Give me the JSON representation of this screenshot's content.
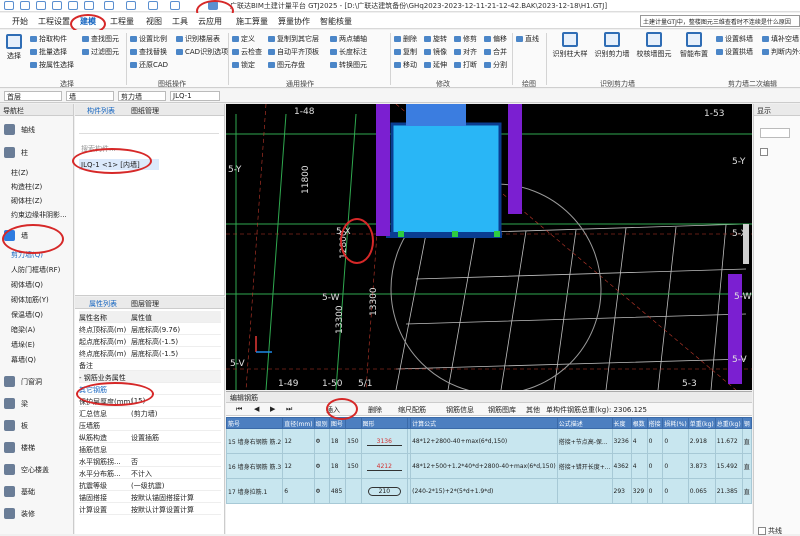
{
  "titlebar": {
    "title": "广联达BIM土建计量平台 GTJ2025 - [D:\\广联达建筑备份\\GHq2023-2023-12-11-21-12-42.BAK\\2023-12-18\\H1.GTJ]"
  },
  "menu": [
    "开始",
    "工程设置",
    "建模",
    "工程量",
    "视图",
    "工具",
    "云应用",
    "施工算量",
    "算量协作",
    "智能核量"
  ],
  "notice": "土建计量GTJ中，整楼图元三维查看时不连续是什么原因",
  "ribbon": {
    "select": "选择",
    "pick": "拾取构件",
    "batch": "批量选择",
    "attr_batch": "按属性选择",
    "find": "查找图元",
    "filter": "过滤图元",
    "set_ratio": "设置比例",
    "restore_cad": "还原CAD",
    "find_replace": "查找替换",
    "recognize_floor": "识别楼层表",
    "cad_recog": "CAD识别选项",
    "define": "定义",
    "cloud_check": "云检查",
    "lock": "锁定",
    "two_point": "两点辅轴",
    "auto_level": "自动平齐顶板",
    "copy_to": "复制到其它层",
    "long_edit": "长度标注",
    "convert": "转换图元",
    "trim": "图元存盘",
    "delete": "删除",
    "copy": "复制",
    "move": "移动",
    "rotate": "旋转",
    "mirror": "镜像",
    "extend": "延伸",
    "trim2": "修剪",
    "align": "对齐",
    "offset": "偏移",
    "break": "打断",
    "merge": "合并",
    "split": "分割",
    "draw": "直线",
    "recognize_col": "识别柱大样",
    "recognize_wall": "识别剪力墙",
    "recognize_table": "识别剪力墙表",
    "calib_wall": "校核墙图元",
    "smart_layout": "智能布置",
    "set_joint": "设置斜墙",
    "set_arc": "设置拱墙",
    "fill_pile": "填补空墙",
    "check_wall": "判断内外墙",
    "groups": [
      "选择",
      "图纸操作",
      "通用操作",
      "修改",
      "绘图",
      "识别剪力墙",
      "剪力墙二次编辑"
    ]
  },
  "ctxbar": {
    "floor": "首层",
    "type": "墙",
    "subtype": "剪力墙",
    "item": "JLQ-1"
  },
  "nav": {
    "title": "导航栏",
    "cats": [
      {
        "label": "轴线"
      },
      {
        "label": "柱"
      },
      {
        "label": "墙"
      },
      {
        "label": "门窗洞"
      },
      {
        "label": "梁"
      },
      {
        "label": "板"
      },
      {
        "label": "楼梯"
      },
      {
        "label": "空心楼盖"
      },
      {
        "label": "基础"
      },
      {
        "label": "装修"
      }
    ],
    "col_items": [
      "柱(Z)",
      "构造柱(Z)",
      "砌体柱(Z)",
      "约束边缘非阴影..."
    ],
    "wall_items": [
      "剪力墙(Q)",
      "人防门框墙(RF)",
      "砌体墙(Q)",
      "砌体加筋(Y)",
      "保温墙(Q)",
      "暗梁(A)",
      "墙垛(E)",
      "幕墙(Q)"
    ]
  },
  "complist": {
    "tabs": [
      "构件列表",
      "图纸管理"
    ],
    "search": "搜索构件...",
    "item": "JLQ-1 <1> [内墙]"
  },
  "props": {
    "tabs": [
      "属性列表",
      "图层管理"
    ],
    "header": {
      "name": "属性名称",
      "value": "属性值"
    },
    "rows": [
      {
        "n": "终点顶标高(m)",
        "v": "层底标高(9.76)"
      },
      {
        "n": "起点底标高(m)",
        "v": "层底标高(-1.5)"
      },
      {
        "n": "终点底标高(m)",
        "v": "层底标高(-1.5)"
      },
      {
        "n": "备注",
        "v": ""
      },
      {
        "n": "- 钢筋业务属性",
        "v": ""
      },
      {
        "n": "其它钢筋",
        "v": ""
      },
      {
        "n": "保护层厚度(mm)",
        "v": "(15)"
      },
      {
        "n": "汇总信息",
        "v": "(剪力墙)"
      },
      {
        "n": "压墙筋",
        "v": ""
      },
      {
        "n": "纵筋构造",
        "v": "设置插筋"
      },
      {
        "n": "插筋信息",
        "v": ""
      },
      {
        "n": "水平钢筋拐...",
        "v": "否"
      },
      {
        "n": "水平分布筋...",
        "v": "不计入"
      },
      {
        "n": "抗震等级",
        "v": "(一级抗震)"
      },
      {
        "n": "锚固搭接",
        "v": "按默认锚固搭接计算"
      },
      {
        "n": "计算设置",
        "v": "按默认计算设置计算"
      }
    ]
  },
  "canvas": {
    "axes_v": [
      "1-48",
      "1-49",
      "1-50",
      "5/1"
    ],
    "axes_h": [
      "5-Y",
      "5-X",
      "5-W",
      "5-V"
    ],
    "axes_right": [
      "1-53",
      "5-Y",
      "5-X",
      "5-W",
      "5-V",
      "5-3"
    ],
    "dims": [
      "11800",
      "12800",
      "13300",
      "13300"
    ]
  },
  "rebar": {
    "title": "编辑钢筋",
    "toolbar": [
      "插入",
      "删除",
      "缩尺配筋",
      "钢筋信息",
      "钢筋图库",
      "其他",
      "单构件钢筋总重(kg): 2306.125"
    ],
    "headers": [
      "筋号",
      "直径(mm)",
      "级别",
      "图号",
      "",
      "图形",
      "",
      "计算公式",
      "公式描述",
      "长度",
      "根数",
      "搭接",
      "损耗(%)",
      "单重(kg)",
      "总重(kg)",
      "钢"
    ],
    "rows": [
      {
        "no": "15",
        "name": "墙身右钢筋 筋.2",
        "d": "12",
        "lv": "Φ",
        "fig": "18",
        "w": "150",
        "shape": "3136",
        "formula": "48*12+2800-40+max(6*d,150)",
        "desc": "搭接+节点高-保...",
        "len": "3236",
        "cnt": "4",
        "lap": "0",
        "loss": "0",
        "unit": "2.918",
        "total": "11.672",
        "t": "直"
      },
      {
        "no": "16",
        "name": "墙身右钢筋 筋.3",
        "d": "12",
        "lv": "Φ",
        "fig": "18",
        "w": "150",
        "shape": "4212",
        "formula": "48*12+500+1.2*40*d+2800-40+max(6*d,150)",
        "desc": "搭接+错开长度+...",
        "len": "4362",
        "cnt": "4",
        "lap": "0",
        "loss": "0",
        "unit": "3.873",
        "total": "15.492",
        "t": "直"
      },
      {
        "no": "17",
        "name": "墙身拉筋.1",
        "d": "6",
        "lv": "Φ",
        "fig": "485",
        "w": "",
        "shape": "210",
        "formula": "(240-2*15)+2*(5*d+1.9*d)",
        "desc": "",
        "len": "293",
        "cnt": "329",
        "loss": "0",
        "lap": "0",
        "unit": "0.065",
        "total": "21.385",
        "t": "直"
      }
    ]
  },
  "rightpanel": {
    "title": "显示",
    "checkbox": "共线"
  }
}
